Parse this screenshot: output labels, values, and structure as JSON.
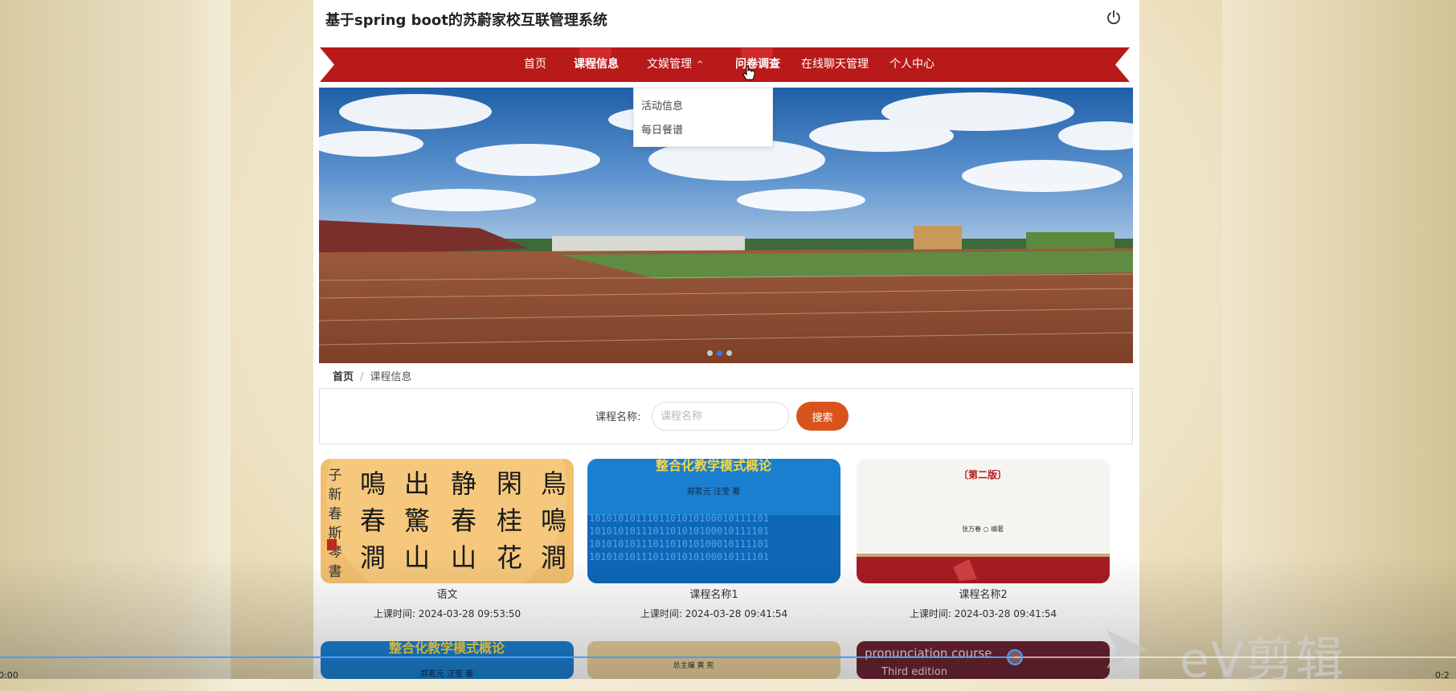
{
  "app": {
    "title": "基于spring boot的苏蔚家校互联管理系统"
  },
  "nav": {
    "items": [
      {
        "label": "首页"
      },
      {
        "label": "课程信息"
      },
      {
        "label": "文娱管理"
      },
      {
        "label": "问卷调查"
      },
      {
        "label": "在线聊天管理"
      },
      {
        "label": "个人中心"
      }
    ],
    "dropdown_caret": "^",
    "dropdown": [
      {
        "label": "活动信息"
      },
      {
        "label": "每日餐谱"
      }
    ]
  },
  "breadcrumb": {
    "home": "首页",
    "separator": "/",
    "current": "课程信息"
  },
  "search": {
    "label": "课程名称:",
    "placeholder": "课程名称",
    "button": "搜索"
  },
  "courses": [
    {
      "name": "语文",
      "time": "上课时间:  2024-03-28 09:53:50"
    },
    {
      "name": "课程名称1",
      "time": "上课时间:  2024-03-28 09:41:54"
    },
    {
      "name": "课程名称2",
      "time": "上课时间:  2024-03-28 09:41:54"
    }
  ],
  "covers": {
    "calligraphy": [
      "鳥",
      "閑",
      "静",
      "出",
      "鳴",
      "子",
      "鳴",
      "桂",
      "春",
      "驚",
      "春",
      "新",
      "澗",
      "花",
      "山",
      "山",
      "澗",
      "春",
      "斯",
      "琴",
      "書"
    ],
    "textbook1": {
      "title": "整合化教学模式概论",
      "authors": "郑茗元    汪莹    著",
      "binary": "1010101011101101010100010111101"
    },
    "textbook2": {
      "edition": "〔第二版〕",
      "author": "张万春 ○ 编著"
    },
    "row2_right": {
      "line1": "pronunciation course",
      "line2": "Third edition"
    },
    "row2_middle": {
      "text": "总主编   黄  宪"
    }
  },
  "carousel": {
    "count": 3,
    "active": 1
  },
  "video": {
    "time_left": "0:00",
    "time_right": "0:2",
    "watermark": "eV剪辑",
    "progress": 0.7
  },
  "colors": {
    "ribbon": "#b81a1a",
    "accent": "#d9541c",
    "progress": "#4a9ff2"
  }
}
